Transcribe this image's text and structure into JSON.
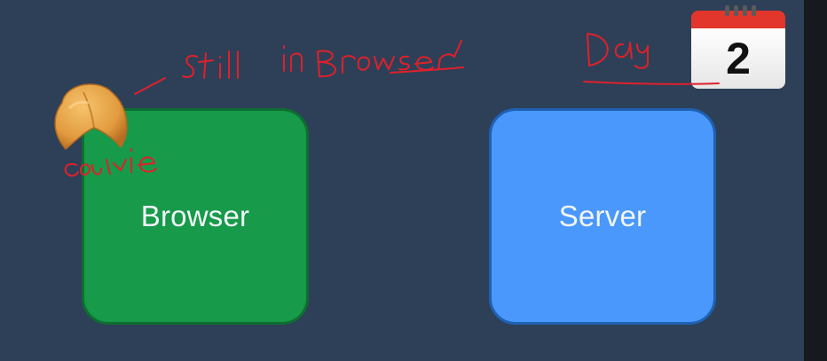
{
  "diagram": {
    "nodes": [
      {
        "id": "browser",
        "label": "Browser",
        "fill": "#179a4a"
      },
      {
        "id": "server",
        "label": "Server",
        "fill": "#4a98fb"
      }
    ],
    "background": "#2d4058"
  },
  "calendar": {
    "day": "2",
    "icon": "calendar-icon"
  },
  "cookie": {
    "icon": "fortune-cookie-icon"
  },
  "annotations": {
    "note_still_in_browser": "Still in Browser",
    "note_day": "Day",
    "note_cookie": "cookie",
    "ink_color": "#e0202a"
  }
}
